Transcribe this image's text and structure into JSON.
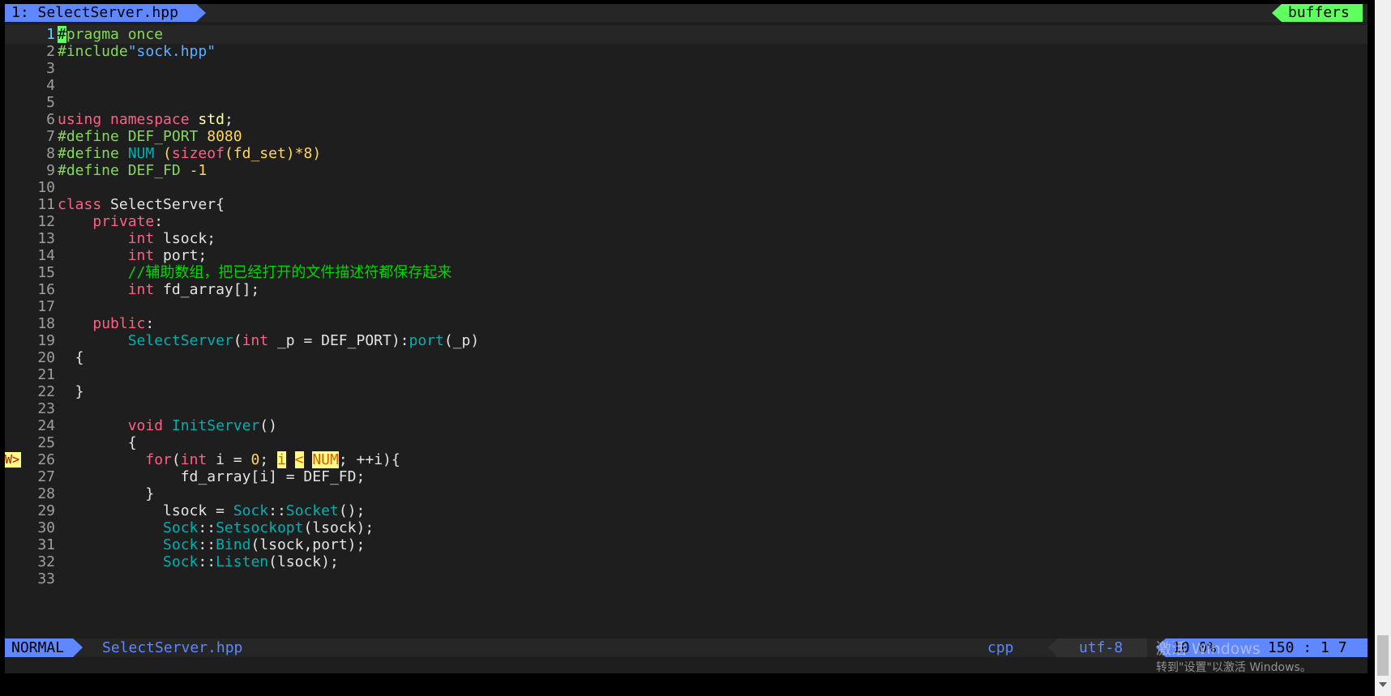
{
  "tabline": {
    "active_tab": "1: SelectServer.hpp",
    "buffers_label": "buffers"
  },
  "editor": {
    "lines": [
      {
        "n": "1",
        "current": true
      },
      {
        "n": "2"
      },
      {
        "n": "3"
      },
      {
        "n": "4"
      },
      {
        "n": "5"
      },
      {
        "n": "6"
      },
      {
        "n": "7"
      },
      {
        "n": "8"
      },
      {
        "n": "9"
      },
      {
        "n": "10"
      },
      {
        "n": "11"
      },
      {
        "n": "12"
      },
      {
        "n": "13"
      },
      {
        "n": "14"
      },
      {
        "n": "15"
      },
      {
        "n": "16"
      },
      {
        "n": "17"
      },
      {
        "n": "18"
      },
      {
        "n": "19"
      },
      {
        "n": "20"
      },
      {
        "n": "21"
      },
      {
        "n": "22"
      },
      {
        "n": "23"
      },
      {
        "n": "24"
      },
      {
        "n": "25"
      },
      {
        "n": "26",
        "sign": "W>"
      },
      {
        "n": "27"
      },
      {
        "n": "28"
      },
      {
        "n": "29"
      },
      {
        "n": "30"
      },
      {
        "n": "31"
      },
      {
        "n": "32"
      },
      {
        "n": "33"
      }
    ],
    "code": {
      "l1": [
        "#",
        "pragma once"
      ],
      "l2": [
        "#include",
        "\"sock.hpp\""
      ],
      "l6": [
        "using",
        " ",
        "namespace",
        " ",
        "std",
        ";"
      ],
      "l7": [
        "#define DEF_PORT ",
        "8080"
      ],
      "l8": [
        "#define ",
        "NUM",
        " (",
        "sizeof",
        "(fd_set)*",
        "8",
        ")"
      ],
      "l9": [
        "#define DEF_FD ",
        "-1"
      ],
      "l11": [
        "class",
        " SelectServer{"
      ],
      "l12": [
        "    ",
        "private",
        ":"
      ],
      "l13": [
        "        ",
        "int",
        " lsock;"
      ],
      "l14": [
        "        ",
        "int",
        " port;"
      ],
      "l15": [
        "        ",
        "//辅助数组，把已经打开的文件描述符都保存起来"
      ],
      "l16": [
        "        ",
        "int",
        " fd_array[];"
      ],
      "l18": [
        "    ",
        "public",
        ":"
      ],
      "l19": [
        "        ",
        "SelectServer",
        "(",
        "int",
        " _p = DEF_PORT):",
        "port",
        "(_p)"
      ],
      "l20": [
        "  {"
      ],
      "l22": [
        "  }"
      ],
      "l24": [
        "        ",
        "void",
        " ",
        "InitServer",
        "()"
      ],
      "l25": [
        "        {"
      ],
      "l26": [
        "          ",
        "for",
        "(",
        "int",
        " i = ",
        "0",
        "; ",
        "i",
        " ",
        "<",
        " ",
        "NUM",
        "; ++i){"
      ],
      "l27": [
        "              fd_array[i] = DEF_FD;"
      ],
      "l28": [
        "          }"
      ],
      "l29": [
        "            lsock = ",
        "Sock",
        "::",
        "Socket",
        "();"
      ],
      "l30": [
        "            ",
        "Sock",
        "::",
        "Setsockopt",
        "(lsock);"
      ],
      "l31": [
        "            ",
        "Sock",
        "::",
        "Bind",
        "(lsock,port);"
      ],
      "l32": [
        "            ",
        "Sock",
        "::",
        "Listen",
        "(lsock);"
      ]
    }
  },
  "statusline": {
    "mode": "NORMAL",
    "filename": "SelectServer.hpp",
    "filetype": "cpp",
    "encoding": "utf-8",
    "percent": "10 0%",
    "position": "150 :  1 7"
  },
  "watermark": {
    "line1": "激活 Windows",
    "line2": "转到\"设置\"以激活 Windows。"
  }
}
